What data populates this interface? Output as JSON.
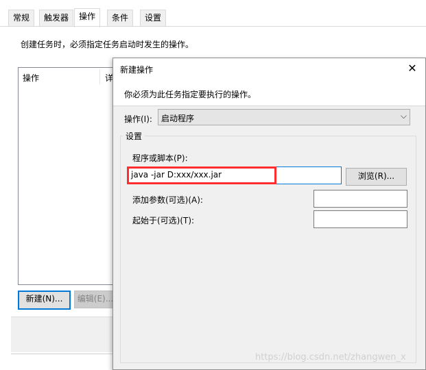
{
  "window": {
    "tabs": [
      "常规",
      "触发器",
      "操作",
      "条件",
      "设置"
    ],
    "active_tab_index": 2,
    "description": "创建任务时，必须指定任务启动时发生的操作。",
    "list_columns": [
      "操作",
      "详"
    ],
    "new_button": "新建(N)...",
    "edit_button": "编辑(E)..."
  },
  "dialog": {
    "title": "新建操作",
    "close_glyph": "✕",
    "instruction": "你必须为此任务指定要执行的操作。",
    "action_label": "操作(I):",
    "action_value": "启动程序",
    "settings_group": "设置",
    "program_label": "程序或脚本(P):",
    "program_value": "java -jar D:xxx/xxx.jar",
    "browse_button": "浏览(R)...",
    "args_label": "添加参数(可选)(A):",
    "args_value": "",
    "startin_label": "起始于(可选)(T):",
    "startin_value": ""
  },
  "colors": {
    "highlight_box": "#ff2d2d",
    "focus_blue": "#0078d7"
  },
  "watermark": "https://blog.csdn.net/zhangwen_x"
}
